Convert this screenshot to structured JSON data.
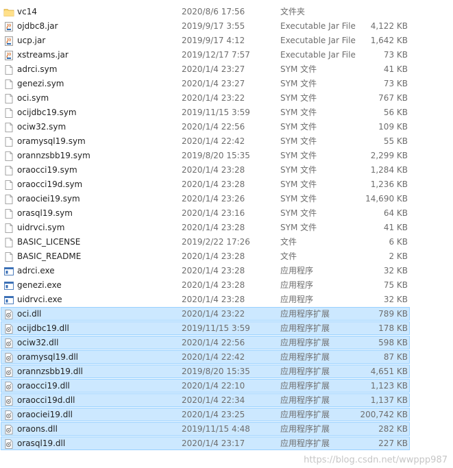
{
  "files": [
    {
      "name": "vc14",
      "date": "2020/8/6 17:56",
      "type": "文件夹",
      "size": "",
      "icon": "folder-icon",
      "selected": false
    },
    {
      "name": "ojdbc8.jar",
      "date": "2019/9/17 3:55",
      "type": "Executable Jar File",
      "size": "4,122 KB",
      "icon": "jar-icon",
      "selected": false
    },
    {
      "name": "ucp.jar",
      "date": "2019/9/17 4:12",
      "type": "Executable Jar File",
      "size": "1,642 KB",
      "icon": "jar-icon",
      "selected": false
    },
    {
      "name": "xstreams.jar",
      "date": "2019/12/17 7:57",
      "type": "Executable Jar File",
      "size": "73 KB",
      "icon": "jar-icon",
      "selected": false
    },
    {
      "name": "adrci.sym",
      "date": "2020/1/4 23:27",
      "type": "SYM 文件",
      "size": "41 KB",
      "icon": "file-icon",
      "selected": false
    },
    {
      "name": "genezi.sym",
      "date": "2020/1/4 23:27",
      "type": "SYM 文件",
      "size": "73 KB",
      "icon": "file-icon",
      "selected": false
    },
    {
      "name": "oci.sym",
      "date": "2020/1/4 23:22",
      "type": "SYM 文件",
      "size": "767 KB",
      "icon": "file-icon",
      "selected": false
    },
    {
      "name": "ocijdbc19.sym",
      "date": "2019/11/15 3:59",
      "type": "SYM 文件",
      "size": "56 KB",
      "icon": "file-icon",
      "selected": false
    },
    {
      "name": "ociw32.sym",
      "date": "2020/1/4 22:56",
      "type": "SYM 文件",
      "size": "109 KB",
      "icon": "file-icon",
      "selected": false
    },
    {
      "name": "oramysql19.sym",
      "date": "2020/1/4 22:42",
      "type": "SYM 文件",
      "size": "55 KB",
      "icon": "file-icon",
      "selected": false
    },
    {
      "name": "orannzsbb19.sym",
      "date": "2019/8/20 15:35",
      "type": "SYM 文件",
      "size": "2,299 KB",
      "icon": "file-icon",
      "selected": false
    },
    {
      "name": "oraocci19.sym",
      "date": "2020/1/4 23:28",
      "type": "SYM 文件",
      "size": "1,284 KB",
      "icon": "file-icon",
      "selected": false
    },
    {
      "name": "oraocci19d.sym",
      "date": "2020/1/4 23:28",
      "type": "SYM 文件",
      "size": "1,236 KB",
      "icon": "file-icon",
      "selected": false
    },
    {
      "name": "oraociei19.sym",
      "date": "2020/1/4 23:26",
      "type": "SYM 文件",
      "size": "14,690 KB",
      "icon": "file-icon",
      "selected": false
    },
    {
      "name": "orasql19.sym",
      "date": "2020/1/4 23:16",
      "type": "SYM 文件",
      "size": "64 KB",
      "icon": "file-icon",
      "selected": false
    },
    {
      "name": "uidrvci.sym",
      "date": "2020/1/4 23:28",
      "type": "SYM 文件",
      "size": "41 KB",
      "icon": "file-icon",
      "selected": false
    },
    {
      "name": "BASIC_LICENSE",
      "date": "2019/2/22 17:26",
      "type": "文件",
      "size": "6 KB",
      "icon": "file-icon",
      "selected": false
    },
    {
      "name": "BASIC_README",
      "date": "2020/1/4 23:28",
      "type": "文件",
      "size": "2 KB",
      "icon": "file-icon",
      "selected": false
    },
    {
      "name": "adrci.exe",
      "date": "2020/1/4 23:28",
      "type": "应用程序",
      "size": "32 KB",
      "icon": "exe-icon",
      "selected": false
    },
    {
      "name": "genezi.exe",
      "date": "2020/1/4 23:28",
      "type": "应用程序",
      "size": "75 KB",
      "icon": "exe-icon",
      "selected": false
    },
    {
      "name": "uidrvci.exe",
      "date": "2020/1/4 23:28",
      "type": "应用程序",
      "size": "32 KB",
      "icon": "exe-icon",
      "selected": false
    },
    {
      "name": "oci.dll",
      "date": "2020/1/4 23:22",
      "type": "应用程序扩展",
      "size": "789 KB",
      "icon": "dll-icon",
      "selected": true
    },
    {
      "name": "ocijdbc19.dll",
      "date": "2019/11/15 3:59",
      "type": "应用程序扩展",
      "size": "178 KB",
      "icon": "dll-icon",
      "selected": true
    },
    {
      "name": "ociw32.dll",
      "date": "2020/1/4 22:56",
      "type": "应用程序扩展",
      "size": "598 KB",
      "icon": "dll-icon",
      "selected": true
    },
    {
      "name": "oramysql19.dll",
      "date": "2020/1/4 22:42",
      "type": "应用程序扩展",
      "size": "87 KB",
      "icon": "dll-icon",
      "selected": true
    },
    {
      "name": "orannzsbb19.dll",
      "date": "2019/8/20 15:35",
      "type": "应用程序扩展",
      "size": "4,651 KB",
      "icon": "dll-icon",
      "selected": true
    },
    {
      "name": "oraocci19.dll",
      "date": "2020/1/4 22:10",
      "type": "应用程序扩展",
      "size": "1,123 KB",
      "icon": "dll-icon",
      "selected": true
    },
    {
      "name": "oraocci19d.dll",
      "date": "2020/1/4 22:34",
      "type": "应用程序扩展",
      "size": "1,137 KB",
      "icon": "dll-icon",
      "selected": true
    },
    {
      "name": "oraociei19.dll",
      "date": "2020/1/4 23:25",
      "type": "应用程序扩展",
      "size": "200,742 KB",
      "icon": "dll-icon",
      "selected": true
    },
    {
      "name": "oraons.dll",
      "date": "2019/11/15 4:48",
      "type": "应用程序扩展",
      "size": "282 KB",
      "icon": "dll-icon",
      "selected": true
    },
    {
      "name": "orasql19.dll",
      "date": "2020/1/4 23:17",
      "type": "应用程序扩展",
      "size": "227 KB",
      "icon": "dll-icon",
      "selected": true
    }
  ],
  "watermark": "https://blog.csdn.net/wwppp987",
  "colors": {
    "selection_fill": "#cce8ff",
    "selection_border": "#99d1ff",
    "folder": "#f8d775",
    "meta_text": "#6d6d6d"
  }
}
